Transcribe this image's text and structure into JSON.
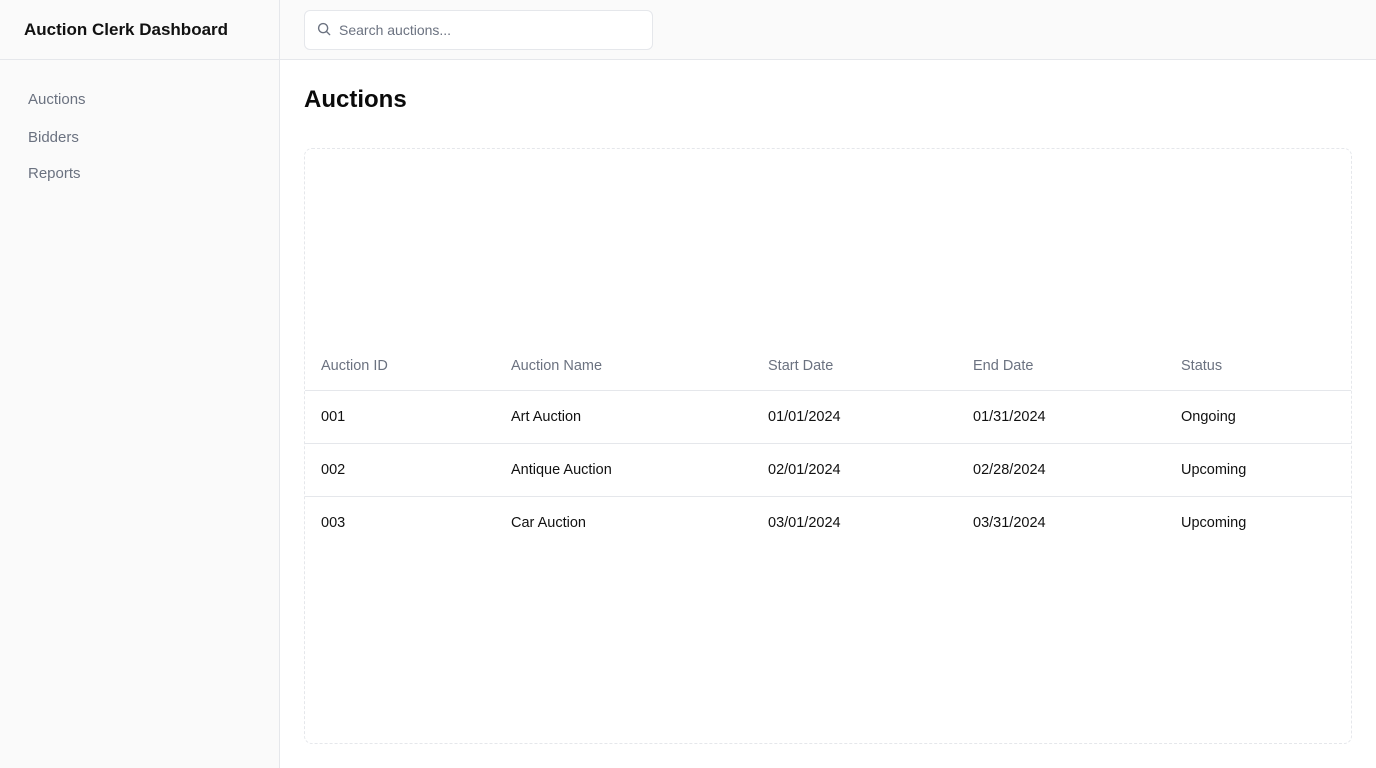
{
  "sidebar": {
    "title": "Auction Clerk Dashboard",
    "items": [
      {
        "label": "Auctions"
      },
      {
        "label": "Bidders"
      },
      {
        "label": "Reports"
      }
    ]
  },
  "search": {
    "placeholder": "Search auctions...",
    "value": "",
    "icon": "search-icon"
  },
  "main": {
    "title": "Auctions"
  },
  "table": {
    "columns": [
      "Auction ID",
      "Auction Name",
      "Start Date",
      "End Date",
      "Status"
    ],
    "rows": [
      [
        "001",
        "Art Auction",
        "01/01/2024",
        "01/31/2024",
        "Ongoing"
      ],
      [
        "002",
        "Antique Auction",
        "02/01/2024",
        "02/28/2024",
        "Upcoming"
      ],
      [
        "003",
        "Car Auction",
        "03/01/2024",
        "03/31/2024",
        "Upcoming"
      ]
    ]
  }
}
